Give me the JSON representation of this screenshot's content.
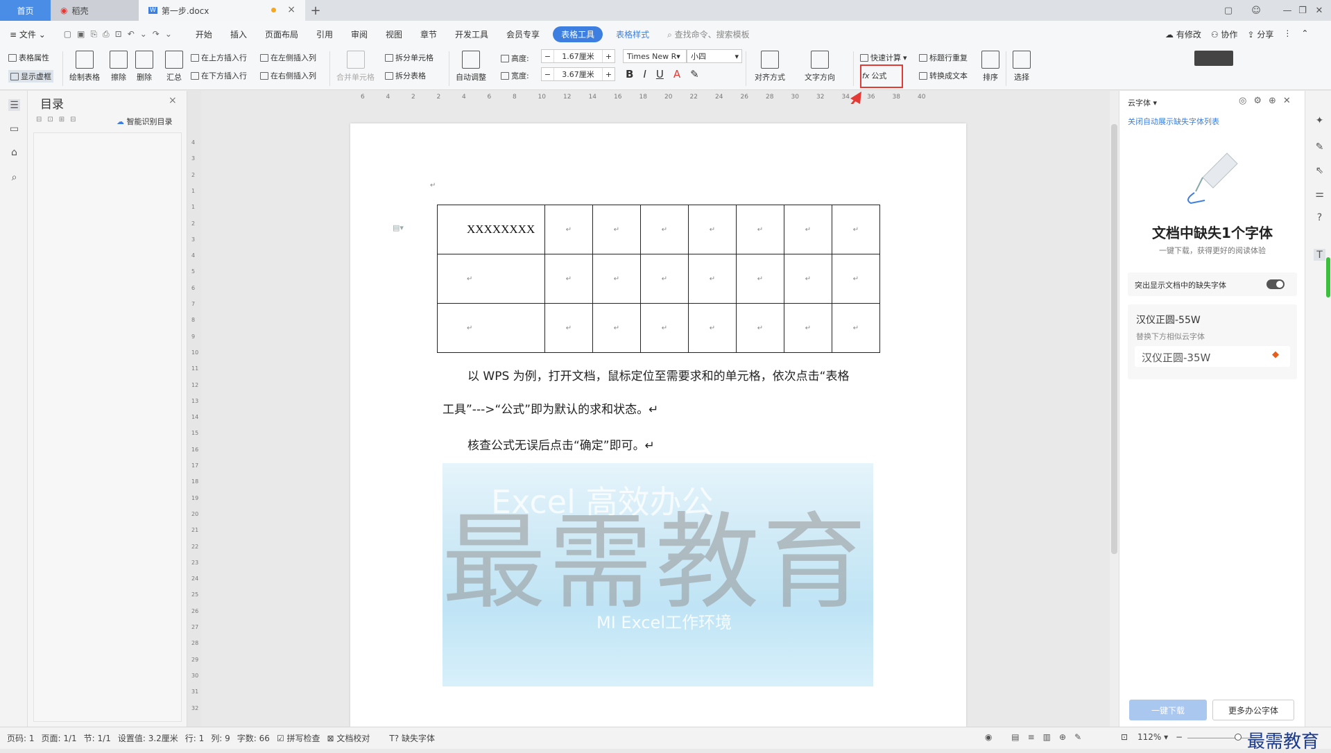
{
  "tabs": {
    "home": "首页",
    "daoke": "稻壳",
    "doc": "第一步.docx",
    "add": "+"
  },
  "menu": {
    "file": "文件",
    "items": [
      "开始",
      "插入",
      "页面布局",
      "引用",
      "审阅",
      "视图",
      "章节",
      "开发工具",
      "会员专享"
    ],
    "table_tools": "表格工具",
    "table_style": "表格样式",
    "search": "查找命令、搜索模板",
    "modify": "有修改",
    "collab": "协作",
    "share": "分享"
  },
  "ribbon": {
    "table_props": "表格属性",
    "show_grid": "显示虚框",
    "draw_table": "绘制表格",
    "erase": "擦除",
    "delete": "删除",
    "summary": "汇总",
    "insert_above": "在上方插入行",
    "insert_below": "在下方插入行",
    "insert_left": "在左侧插入列",
    "insert_right": "在右侧插入列",
    "merge_cells": "合并单元格",
    "split_cells": "拆分单元格",
    "split_table": "拆分表格",
    "auto_fit": "自动调整",
    "height_label": "高度:",
    "height_value": "1.67厘米",
    "width_label": "宽度:",
    "width_value": "3.67厘米",
    "font_name": "Times New R",
    "font_size": "小四",
    "align": "对齐方式",
    "text_dir": "文字方向",
    "quick_calc": "快速计算",
    "formula": "公式",
    "title_repeat": "标题行重复",
    "to_text": "转换成文本",
    "sort": "排序",
    "select": "选择"
  },
  "toc": {
    "title": "目录",
    "smart": "智能识别目录"
  },
  "document": {
    "cell_text": "XXXXXXXX",
    "para1": "以 WPS 为例，打开文档，鼠标定位至需要求和的单元格，依次点击“表格",
    "para2": "工具”--->“公式”即为默认的求和状态。↵",
    "para3": "核查公式无误后点击“确定”即可。↵",
    "watermark": "最需教育",
    "img_text1": "Excel 高效办公",
    "img_text2": "MI Excel工作环境",
    "ret": "↵"
  },
  "cloud_font": {
    "title": "云字体",
    "close_auto": "关闭自动展示缺失字体列表",
    "heading": "文档中缺失1个字体",
    "sub": "一键下载，获得更好的阅读体验",
    "highlight": "突出显示文档中的缺失字体",
    "missing_font": "汉仪正圆-55W",
    "replace_hint": "替换下方相似云字体",
    "alt_font": "汉仪正圆-35W",
    "download": "一键下载",
    "more": "更多办公字体"
  },
  "status": {
    "page_no": "页码: 1",
    "pages": "页面: 1/1",
    "section": "节: 1/1",
    "setting": "设置值: 3.2厘米",
    "row": "行: 1",
    "col": "列: 9",
    "words": "字数: 66",
    "spell": "拼写检查",
    "proof": "文档校对",
    "missing": "缺失字体",
    "zoom": "112%",
    "brand": "最需教育"
  },
  "hruler_ticks": [
    "6",
    "4",
    "2",
    "2",
    "4",
    "6",
    "8",
    "10",
    "12",
    "14",
    "16",
    "18",
    "20",
    "22",
    "24",
    "26",
    "28",
    "30",
    "32",
    "34",
    "36",
    "38",
    "40"
  ],
  "vruler_ticks": [
    "4",
    "3",
    "2",
    "1",
    "1",
    "2",
    "3",
    "4",
    "5",
    "6",
    "7",
    "8",
    "9",
    "10",
    "11",
    "12",
    "13",
    "14",
    "15",
    "16",
    "17",
    "18",
    "19",
    "20",
    "21",
    "22",
    "23",
    "24",
    "25",
    "26",
    "27",
    "28",
    "29",
    "30",
    "31",
    "32"
  ]
}
